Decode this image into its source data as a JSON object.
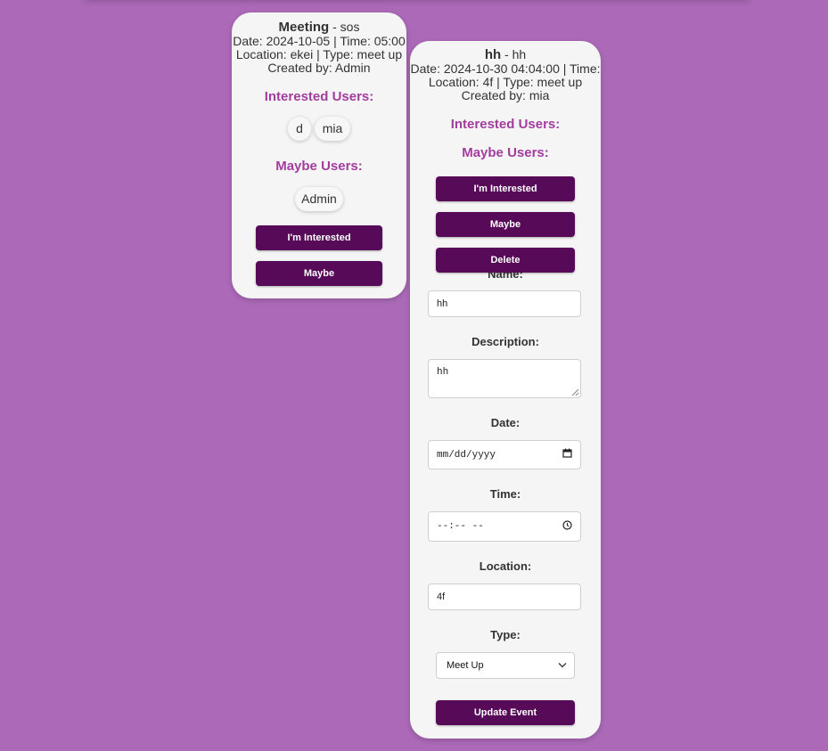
{
  "events": [
    {
      "title": "Meeting",
      "subtitle": " - sos",
      "line1": "Date: 2024-10-05 | Time: 05:00",
      "line2": "Location: ekei | Type: meet up",
      "line3": "Created by: Admin",
      "interested_heading": "Interested Users:",
      "interested_users": [
        "d",
        "mia"
      ],
      "maybe_heading": "Maybe Users:",
      "maybe_users": [
        "Admin"
      ],
      "interested_button": "I'm Interested",
      "maybe_button": "Maybe"
    },
    {
      "title": "hh",
      "subtitle": " - hh",
      "line1": "Date: 2024-10-30 04:04:00 | Time:",
      "line2": "Location: 4f | Type: meet up",
      "line3": "Created by: mia",
      "interested_heading": "Interested Users:",
      "maybe_heading": "Maybe Users:",
      "interested_button": "I'm Interested",
      "maybe_button": "Maybe",
      "delete_button": "Delete",
      "form": {
        "name_label": "Name:",
        "name_value": "hh",
        "description_label": "Description:",
        "description_value": "hh",
        "date_label": "Date:",
        "date_placeholder": "mm/dd/yyyy",
        "time_label": "Time:",
        "time_placeholder": "--:-- --",
        "location_label": "Location:",
        "location_value": "4f",
        "type_label": "Type:",
        "type_selected": "Meet Up",
        "submit_button": "Update Event"
      }
    }
  ],
  "icons": {
    "calendar": "calendar-icon",
    "clock": "clock-icon",
    "chevron": "chevron-down-icon"
  },
  "colors": {
    "background": "#ab69b7",
    "card": "#f5f5f5",
    "heading": "#a23c9d",
    "button": "#560a57"
  }
}
